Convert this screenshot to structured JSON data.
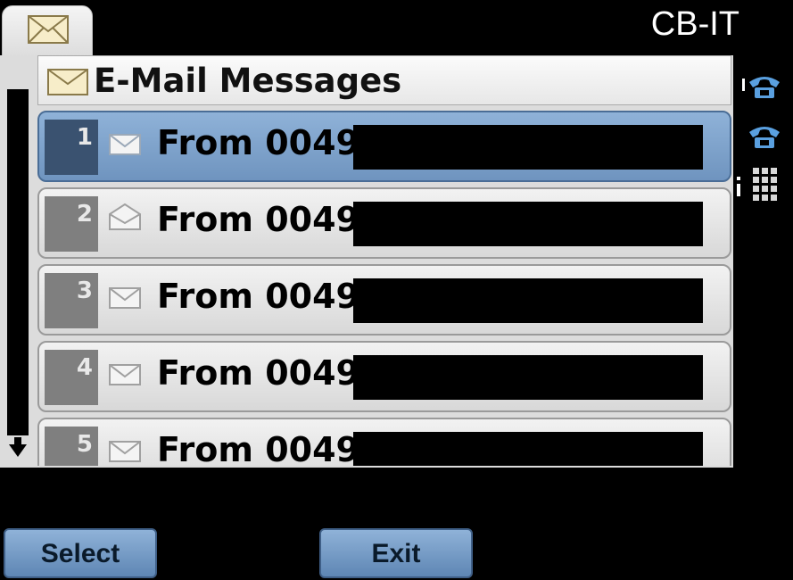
{
  "brand": "CB-IT",
  "header": {
    "title": "E-Mail Messages",
    "icon": "envelope-icon"
  },
  "messages": [
    {
      "num": "1",
      "from": "From 0049",
      "state": "unread",
      "selected": true
    },
    {
      "num": "2",
      "from": "From 0049",
      "state": "read",
      "selected": false
    },
    {
      "num": "3",
      "from": "From 0049",
      "state": "unread",
      "selected": false
    },
    {
      "num": "4",
      "from": "From 0049",
      "state": "unread",
      "selected": false
    },
    {
      "num": "5",
      "from": "From 0049",
      "state": "unread",
      "selected": false
    }
  ],
  "softkeys": {
    "select": "Select",
    "exit": "Exit"
  },
  "colors": {
    "accent": "#6f94bf",
    "selected_num_bg": "#3a5270"
  }
}
